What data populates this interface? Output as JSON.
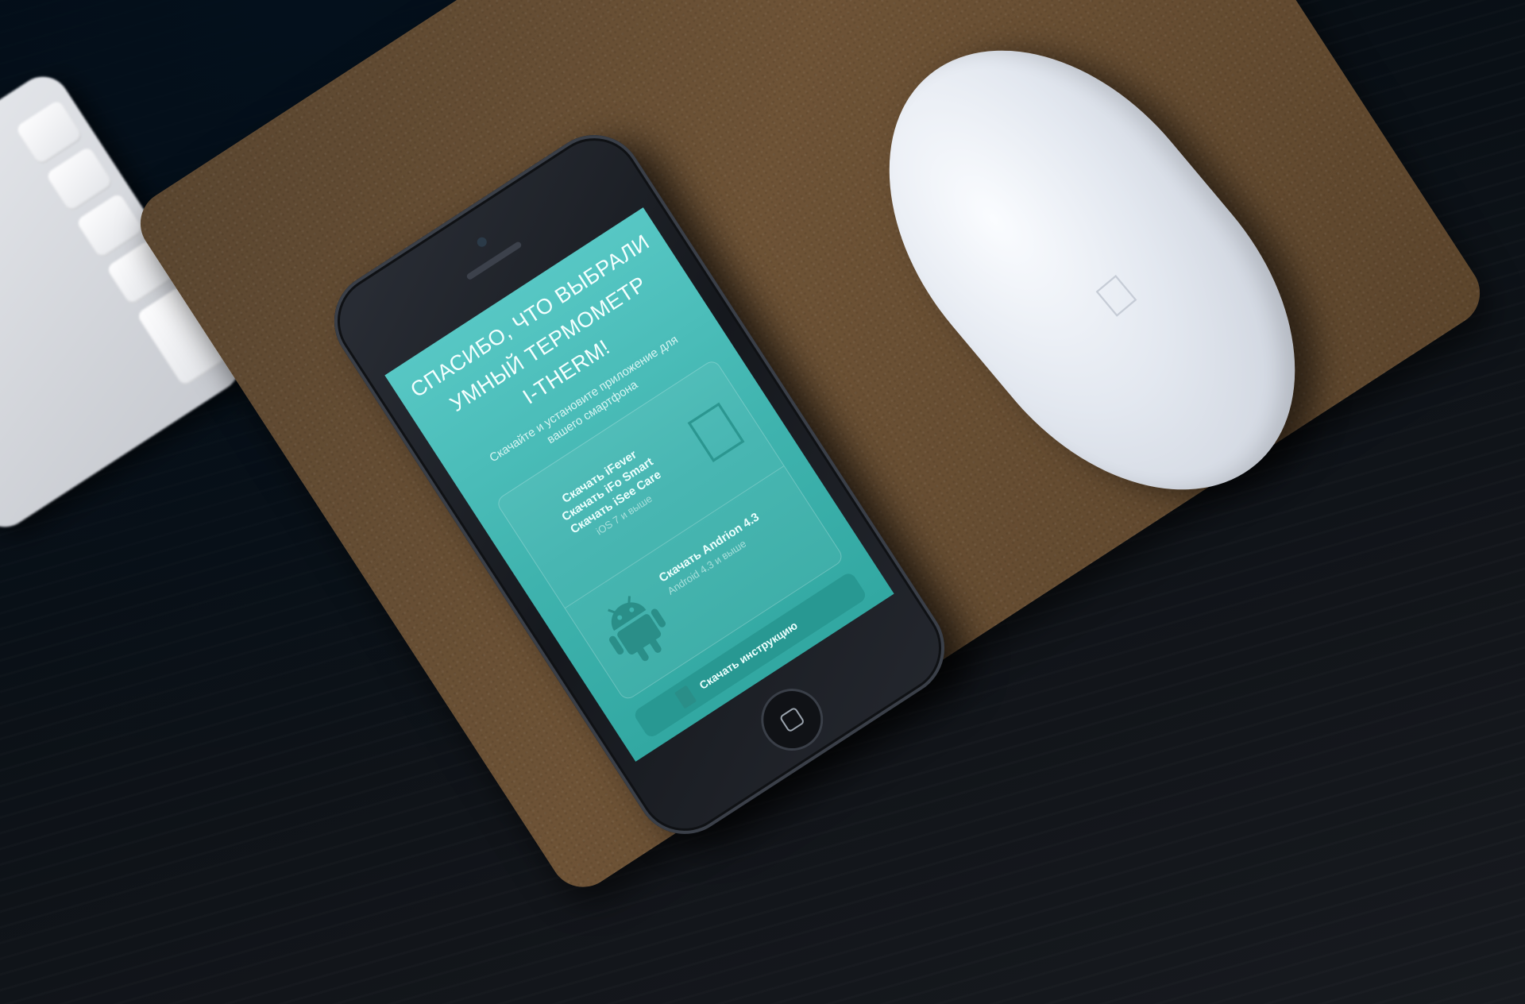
{
  "screen": {
    "headline_line1": "СПАСИБО, ЧТО ВЫБРАЛИ",
    "headline_line2": "УМНЫЙ ТЕРМОМЕТР",
    "headline_line3": "I-THERM!",
    "subtitle": "Скачайте и установите приложение для вашего смартфона",
    "ios": {
      "link1": "Скачать iFever",
      "link2": "Скачать iFo Smart",
      "link3": "Скачать iSee Care",
      "requirement": "iOS 7 и выше",
      "icon": "apple-logo-icon"
    },
    "android": {
      "link": "Скачать Andrion 4.3",
      "requirement": "Android 4.3 и выше",
      "icon": "android-robot-icon"
    },
    "manual_button": {
      "label": "Скачать инструкцию",
      "icon": "document-icon"
    }
  },
  "colors": {
    "screen_accent": "#3fb3ae",
    "desk": "#0a1016",
    "cork": "#6e5336"
  }
}
